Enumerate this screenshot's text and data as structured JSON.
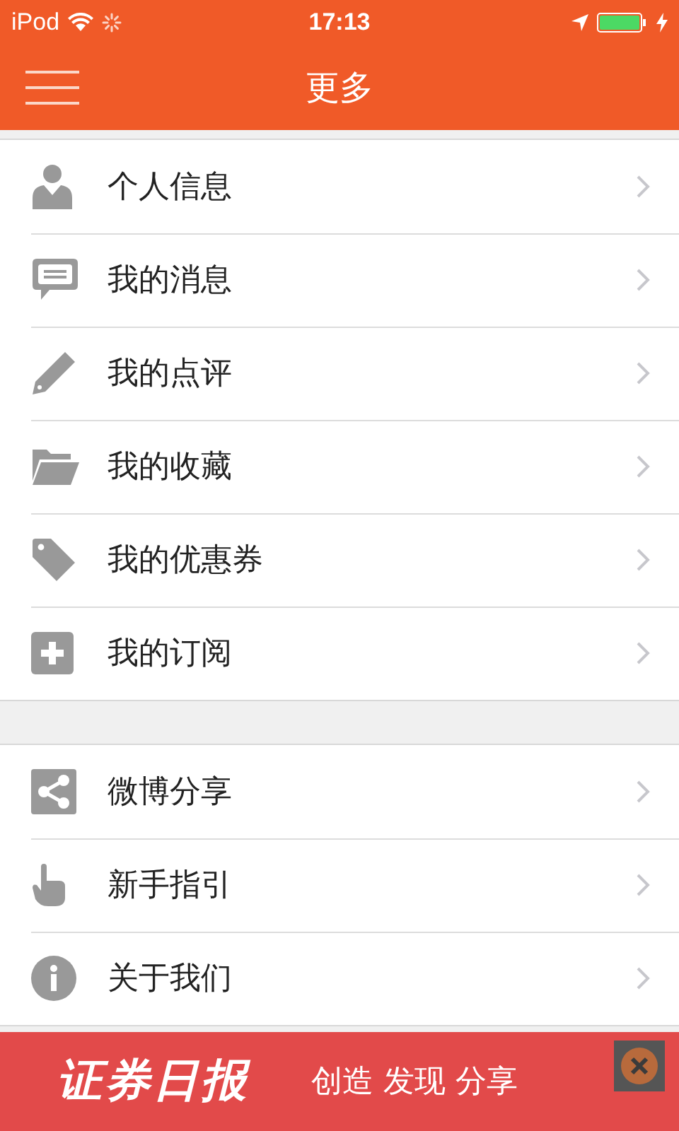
{
  "status_bar": {
    "carrier": "iPod",
    "time": "17:13"
  },
  "header": {
    "title": "更多"
  },
  "sections": [
    {
      "items": [
        {
          "label": "个人信息"
        },
        {
          "label": "我的消息"
        },
        {
          "label": "我的点评"
        },
        {
          "label": "我的收藏"
        },
        {
          "label": "我的优惠券"
        },
        {
          "label": "我的订阅"
        }
      ]
    },
    {
      "items": [
        {
          "label": "微博分享"
        },
        {
          "label": "新手指引"
        },
        {
          "label": "关于我们"
        }
      ]
    }
  ],
  "ad_banner": {
    "logo": "证券日报",
    "slogan": "创造 发现 分享"
  }
}
